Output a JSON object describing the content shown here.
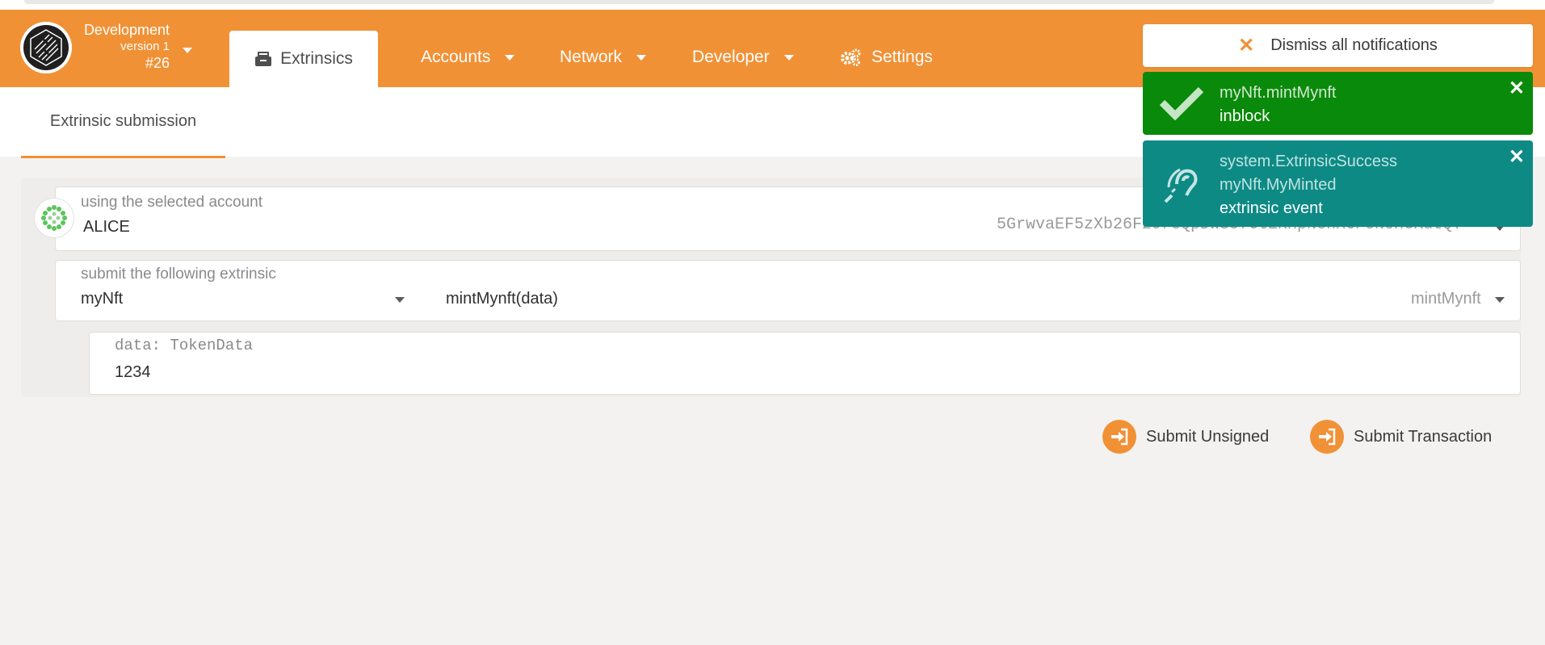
{
  "chain": {
    "name": "Development",
    "version": "version 1",
    "block": "#26"
  },
  "nav": {
    "active_tab": "Extrinsics",
    "accounts": "Accounts",
    "network": "Network",
    "developer": "Developer",
    "settings": "Settings"
  },
  "subtab": "Extrinsic submission",
  "account": {
    "label": "using the selected account",
    "name": "ALICE",
    "address": "5GrwvaEF5zXb26Fz9rcQpDWS57CtERHpNehXCPcNoHGKutQY"
  },
  "extrinsic": {
    "label": "submit the following extrinsic",
    "module": "myNft",
    "method_signature": "mintMynft(data)",
    "method": "mintMynft"
  },
  "param": {
    "label": "data: TokenData",
    "value": "1234"
  },
  "actions": {
    "unsigned": "Submit Unsigned",
    "transaction": "Submit Transaction"
  },
  "notifications": {
    "dismiss_all": "Dismiss all notifications",
    "items": [
      {
        "title": "myNft.mintMynft",
        "status": "inblock",
        "color": "#0a8a0a",
        "icon": "check-icon"
      },
      {
        "title": "system.ExtrinsicSuccess",
        "title2": "myNft.MyMinted",
        "status": "extrinsic event",
        "color": "#0e8a85",
        "icon": "assistive-listening-icon"
      }
    ]
  },
  "colors": {
    "accent": "#f19135"
  }
}
